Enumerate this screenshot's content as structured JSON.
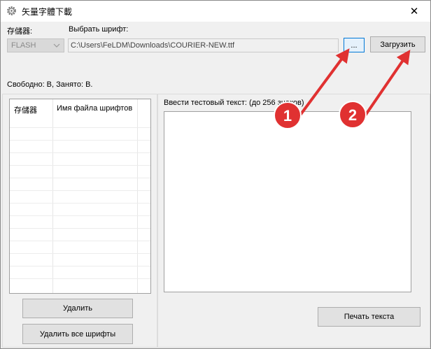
{
  "window": {
    "title": "矢量字體下載",
    "close_glyph": "✕"
  },
  "storage": {
    "label": "存儲器:",
    "selected": "FLASH"
  },
  "font_select": {
    "label": "Выбрать шрифт:",
    "path": "C:\\Users\\FeLDM\\Downloads\\COURIER-NEW.ttf",
    "browse_label": "...",
    "load_label": "Загрузить"
  },
  "status": {
    "text": "Свободно: B, Занято: B."
  },
  "font_list": {
    "columns": [
      "存儲器",
      "Имя файла шрифтов"
    ],
    "rows": []
  },
  "test_text": {
    "label": "Ввести тестовый текст: (до 256 знаков)",
    "value": ""
  },
  "buttons": {
    "delete": "Удалить",
    "delete_all": "Удалить все шрифты",
    "print": "Печать текста"
  },
  "annotations": {
    "badge_1": "1",
    "badge_2": "2",
    "color": "#e03131"
  }
}
